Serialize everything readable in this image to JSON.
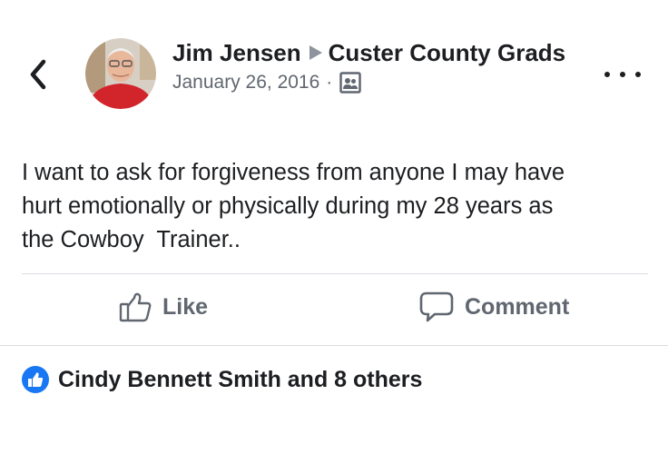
{
  "header": {
    "author": "Jim Jensen",
    "group": "Custer County Grads",
    "date": "January 26, 2016",
    "separator": "·"
  },
  "icons": {
    "back": "chevron-left-icon",
    "arrow": "triangle-right-icon",
    "privacy": "group-audience-icon",
    "more": "more-horizontal-icon",
    "like": "thumbs-up-icon",
    "comment": "speech-bubble-icon",
    "reaction": "like-reaction-icon"
  },
  "post": {
    "text": "I want to ask for forgiveness from anyone I may have\nhurt emotionally or physically during my 28 years as\nthe Cowboy  Trainer.."
  },
  "actions": {
    "like_label": "Like",
    "comment_label": "Comment"
  },
  "reactions": {
    "summary": "Cindy Bennett Smith and 8 others"
  },
  "colors": {
    "text_primary": "#1c1e21",
    "text_secondary": "#606770",
    "facebook_blue": "#1877f2",
    "divider": "#dadde1"
  }
}
